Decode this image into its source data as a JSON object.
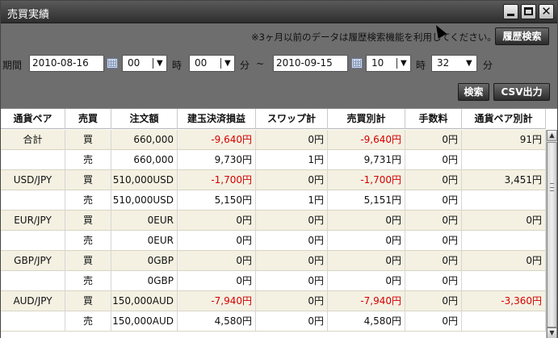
{
  "window": {
    "title": "売買実績"
  },
  "notice": "※3ヶ月以前のデータは履歴検索機能を利用してください。",
  "buttons": {
    "history": "履歴検索",
    "search": "検索",
    "csv": "CSV出力"
  },
  "period": {
    "label": "期間",
    "from_date": "2010-08-16",
    "from_hour": "00",
    "from_min": "00",
    "to_date": "2010-09-15",
    "to_hour": "10",
    "to_min": "32",
    "hour_label": "時",
    "min_label": "分",
    "separator": "~"
  },
  "table": {
    "columns": [
      "通貨ペア",
      "売買",
      "注文額",
      "建玉決済損益",
      "スワップ計",
      "売買別計",
      "手数料",
      "通貨ペア別計"
    ],
    "rows": [
      [
        "合計",
        "買",
        "660,000",
        "-9,640円",
        "0円",
        "-9,640円",
        "0円",
        "91円"
      ],
      [
        "",
        "売",
        "660,000",
        "9,730円",
        "1円",
        "9,731円",
        "0円",
        ""
      ],
      [
        "USD/JPY",
        "買",
        "510,000USD",
        "-1,700円",
        "0円",
        "-1,700円",
        "0円",
        "3,451円"
      ],
      [
        "",
        "売",
        "510,000USD",
        "5,150円",
        "1円",
        "5,151円",
        "0円",
        ""
      ],
      [
        "EUR/JPY",
        "買",
        "0EUR",
        "0円",
        "0円",
        "0円",
        "0円",
        "0円"
      ],
      [
        "",
        "売",
        "0EUR",
        "0円",
        "0円",
        "0円",
        "0円",
        ""
      ],
      [
        "GBP/JPY",
        "買",
        "0GBP",
        "0円",
        "0円",
        "0円",
        "0円",
        "0円"
      ],
      [
        "",
        "売",
        "0GBP",
        "0円",
        "0円",
        "0円",
        "0円",
        ""
      ],
      [
        "AUD/JPY",
        "買",
        "150,000AUD",
        "-7,940円",
        "0円",
        "-7,940円",
        "0円",
        "-3,360円"
      ],
      [
        "",
        "売",
        "150,000AUD",
        "4,580円",
        "0円",
        "4,580円",
        "0円",
        ""
      ]
    ]
  },
  "colors": {
    "negative": "#d40000",
    "row_shade": "#f4f1e2"
  },
  "icons": [
    "minimize-icon",
    "maximize-icon",
    "close-icon",
    "calendar-icon",
    "chevron-down-icon"
  ]
}
